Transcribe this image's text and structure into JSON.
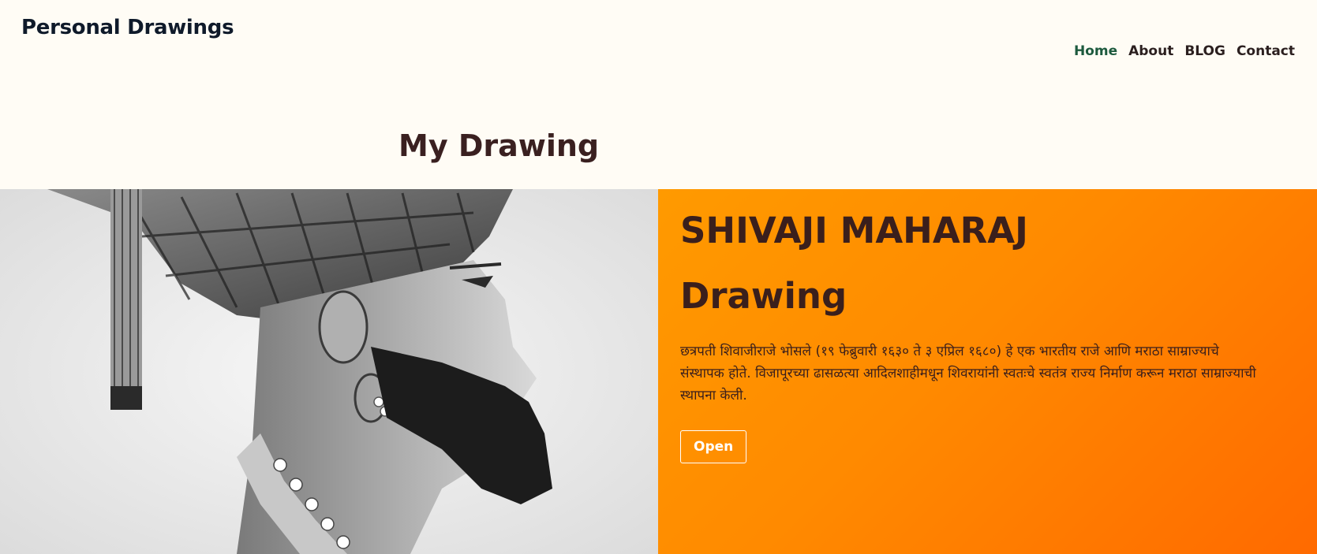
{
  "site": {
    "brand": "Personal Drawings"
  },
  "nav": {
    "items": [
      {
        "label": "Home",
        "active": true
      },
      {
        "label": "About",
        "active": false
      },
      {
        "label": "BLOG",
        "active": false
      },
      {
        "label": "Contact",
        "active": false
      }
    ]
  },
  "section": {
    "title": "My Drawing"
  },
  "hero": {
    "heading_line1": "SHIVAJI MAHARAJ",
    "heading_line2": "Drawing",
    "description": "छत्रपती शिवाजीराजे भोसले (१९ फेब्रुवारी १६३० ते ३ एप्रिल १६८०) हे एक भारतीय राजे आणि मराठा साम्राज्याचे संस्थापक होते. विजापूरच्या ढासळत्या आदिलशाहीमधून शिवरायांनी स्वतःचे स्वतंत्र राज्य निर्माण करून मराठा साम्राज्याची स्थापना केली.",
    "button_label": "Open",
    "image": "pencil-portrait-drawing"
  },
  "colors": {
    "background": "#fffcf5",
    "nav_active": "#1d5a3e",
    "panel_start": "#ff9a00",
    "panel_end": "#ff6a00",
    "heading": "#3a1f1c"
  }
}
